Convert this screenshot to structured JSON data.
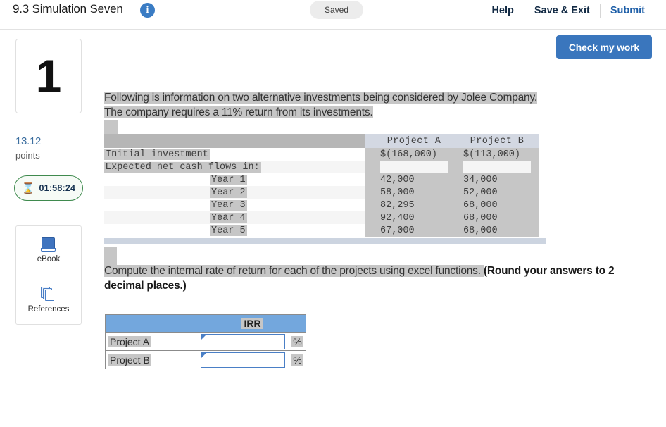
{
  "header": {
    "title": "9.3 Simulation Seven",
    "info_icon": "info-icon",
    "saved_label": "Saved",
    "nav": [
      {
        "label": "Help",
        "style": "dark"
      },
      {
        "label": "Save & Exit",
        "style": "dark"
      },
      {
        "label": "Submit",
        "style": "blue"
      }
    ]
  },
  "sidebar": {
    "question_number": "1",
    "points_value": "13.12",
    "points_label": "points",
    "timer": "01:58:24",
    "timer_icon": "hourglass-icon",
    "tools": [
      {
        "label": "eBook",
        "icon": "ebook-icon"
      },
      {
        "label": "References",
        "icon": "references-icon"
      }
    ]
  },
  "toolbar": {
    "check_my_work": "Check my work"
  },
  "main": {
    "intro_line1": "Following is information on two alternative investments being considered by Jolee Company.",
    "intro_line2": "The company requires a 11% return from its investments.",
    "compute_text": "Compute the internal rate of return for each of the projects using excel functions. ",
    "compute_bold": "(Round your answers to 2 decimal places.)"
  },
  "data_table": {
    "columns": [
      "",
      "Project A",
      "Project B"
    ],
    "rows": [
      {
        "label": "Initial investment",
        "indent": false,
        "a": "$(168,000)",
        "b": "$(113,000)"
      },
      {
        "label": "Expected net cash flows in:",
        "indent": false,
        "a": "",
        "b": ""
      },
      {
        "label": "Year 1",
        "indent": true,
        "a": "42,000",
        "b": "34,000"
      },
      {
        "label": "Year 2",
        "indent": true,
        "a": "58,000",
        "b": "52,000"
      },
      {
        "label": "Year 3",
        "indent": true,
        "a": "82,295",
        "b": "68,000"
      },
      {
        "label": "Year 4",
        "indent": true,
        "a": "92,400",
        "b": "68,000"
      },
      {
        "label": "Year 5",
        "indent": true,
        "a": "67,000",
        "b": "68,000"
      }
    ]
  },
  "answer_table": {
    "header_blank": "",
    "header_irr": "IRR",
    "rows": [
      {
        "label": "Project A",
        "value": "",
        "unit": "%"
      },
      {
        "label": "Project B",
        "value": "",
        "unit": "%"
      }
    ]
  },
  "colors": {
    "accent_blue": "#3a76bd",
    "table_header_blue": "#73a7dd",
    "highlight_gray": "#c6c6c6",
    "timer_green": "#3f8a4e",
    "link_blue": "#1e5fa8"
  }
}
